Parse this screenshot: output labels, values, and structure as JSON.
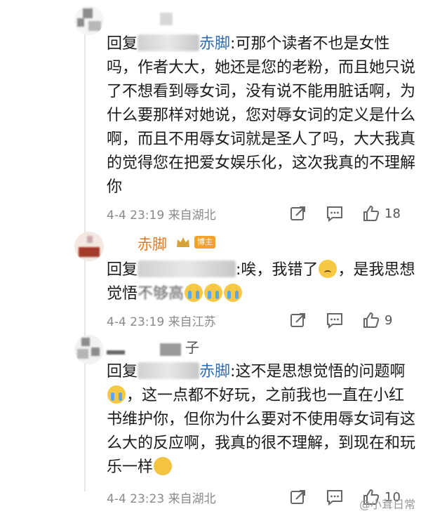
{
  "comments": [
    {
      "reply_prefix": "回复",
      "mention_visible": "赤脚",
      "text": ":可那个读者不也是女性吗，作者大大，她还是您的老粉，而且她只说了不想看到辱女词，没有说不能用脏话啊，为什么要那样对她说，您对辱女词的定义是什么啊，而且不用辱女词就是圣人了吗，大大我真的觉得您在把爱女娱乐化，这次我真的不理解你",
      "time": "4-4 23:19",
      "location": "来自湖北",
      "likes": "18"
    },
    {
      "username": "赤脚",
      "badge": "博主",
      "reply_prefix": "回复",
      "text_part1": ":唉，我错了",
      "text_part2": "，是我思想觉悟",
      "text_part3": "不够高",
      "time": "4-4 23:19",
      "location": "来自江苏",
      "likes": "9"
    },
    {
      "username_visible": "子",
      "reply_prefix": "回复",
      "mention_visible": "赤脚",
      "text_part1": ":这不是思想觉悟的问题啊",
      "text_part2": "，这一点都不好玩，之前我也一直在小红书维护你，但你为什么要对不使用辱女词有这么大的反应啊，我真的很不理解，到现在和玩乐一样",
      "time": "4-4 23:23",
      "location": "来自湖北",
      "likes": "10"
    }
  ],
  "watermark": "@小茸日常",
  "icons": {
    "share": "share-icon",
    "comment": "comment-icon",
    "like": "like-icon"
  }
}
